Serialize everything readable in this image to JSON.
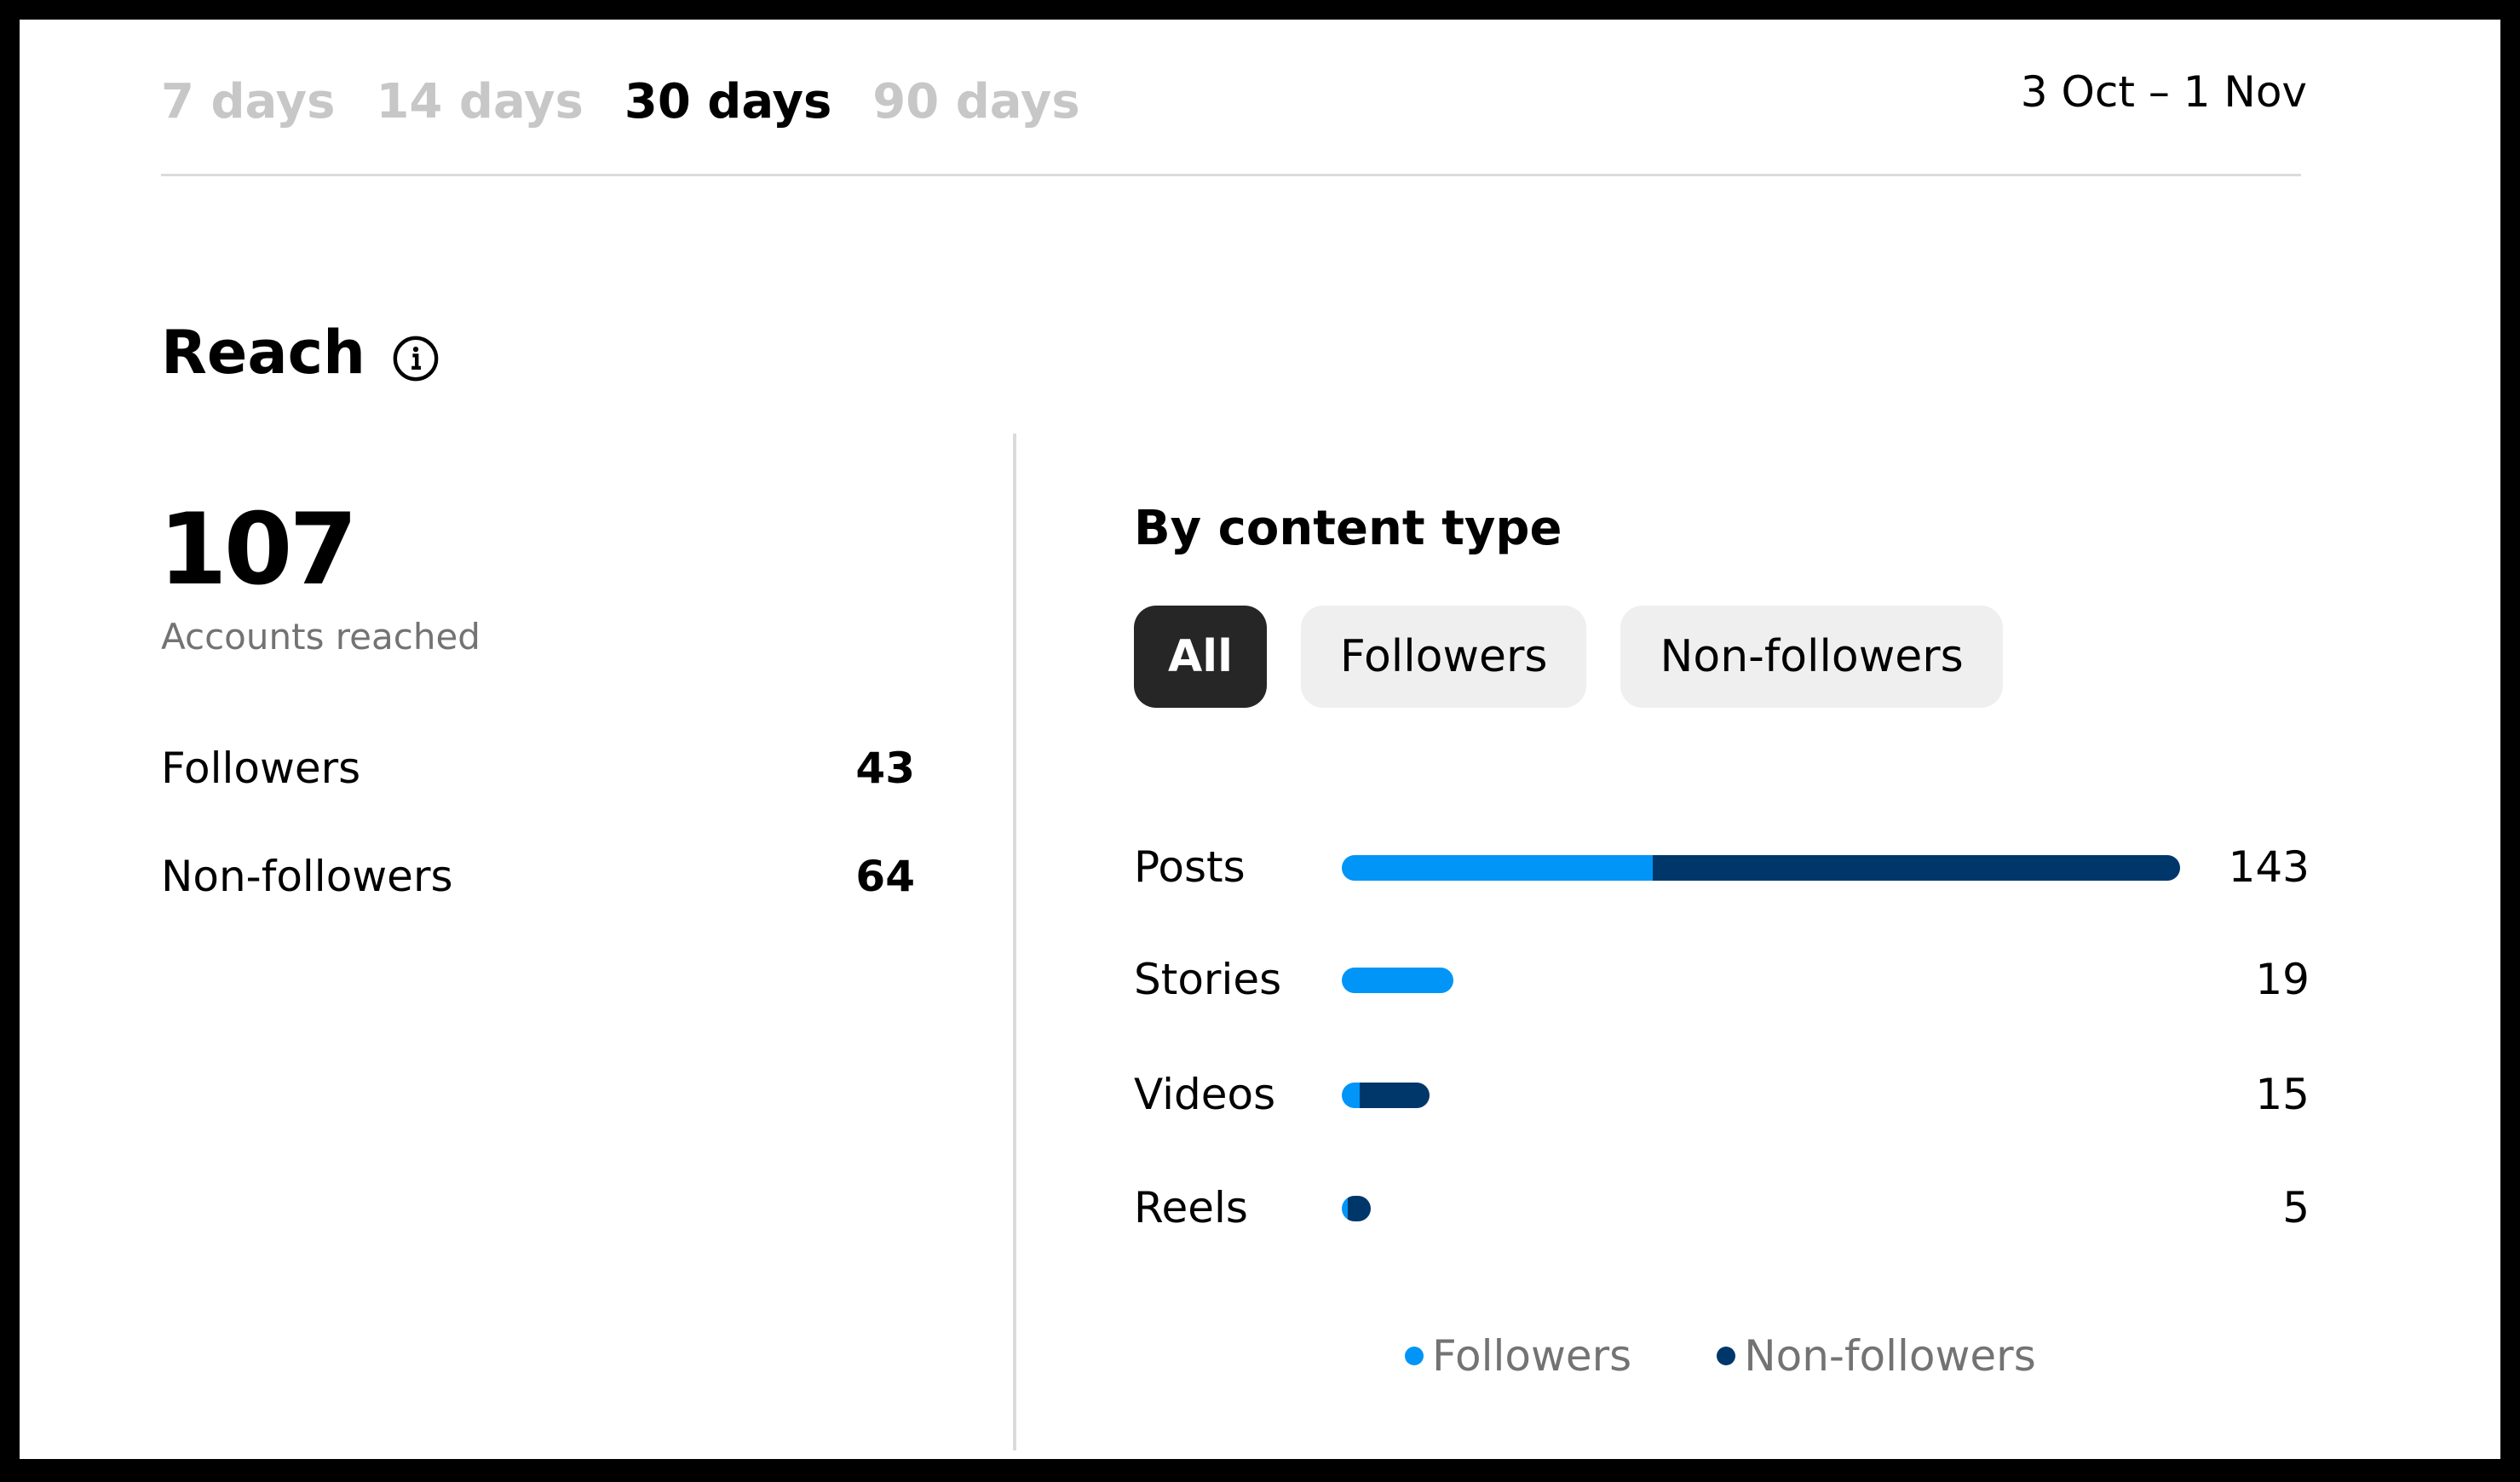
{
  "tabs": [
    {
      "label": "7 days",
      "active": false
    },
    {
      "label": "14 days",
      "active": false
    },
    {
      "label": "30 days",
      "active": true
    },
    {
      "label": "90 days",
      "active": false
    }
  ],
  "date_range": "3 Oct – 1 Nov",
  "reach": {
    "title": "Reach",
    "info_icon": "info-icon",
    "total": "107",
    "total_label": "Accounts reached",
    "breakdown": [
      {
        "label": "Followers",
        "value": "43"
      },
      {
        "label": "Non-followers",
        "value": "64"
      }
    ]
  },
  "content_type": {
    "title": "By content type",
    "filters": [
      {
        "label": "All",
        "active": true
      },
      {
        "label": "Followers",
        "active": false
      },
      {
        "label": "Non-followers",
        "active": false
      }
    ]
  },
  "colors": {
    "followers": "#0095f6",
    "non_followers": "#00376b"
  },
  "chart_data": {
    "type": "bar",
    "orientation": "horizontal",
    "stacked": true,
    "title": "By content type",
    "categories": [
      "Posts",
      "Stories",
      "Videos",
      "Reels"
    ],
    "totals": [
      143,
      19,
      15,
      5
    ],
    "series": [
      {
        "name": "Followers",
        "values": [
          53,
          19,
          3,
          1
        ]
      },
      {
        "name": "Non-followers",
        "values": [
          90,
          0,
          12,
          4
        ]
      }
    ],
    "xlim": [
      0,
      143
    ],
    "grid": false,
    "legend": "bottom-center"
  },
  "legend": [
    {
      "label": "Followers",
      "color_key": "followers"
    },
    {
      "label": "Non-followers",
      "color_key": "non_followers"
    }
  ]
}
